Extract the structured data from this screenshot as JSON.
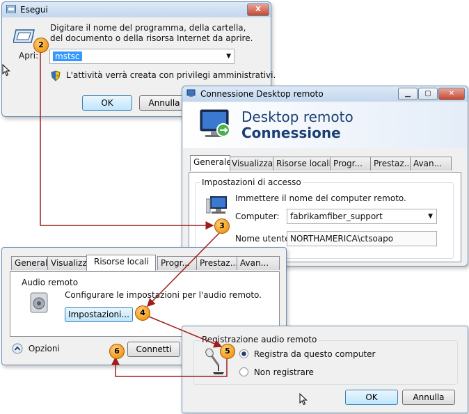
{
  "run_dialog": {
    "title": "Esegui",
    "close_label": "X",
    "description": "Digitare il nome del programma, della cartella,\ndel documento o della risorsa Internet da aprire.",
    "open_label": "Apri:",
    "open_value": "mstsc",
    "admin_note": "L'attività verrà creata con privilegi amministrativi.",
    "ok_label": "OK",
    "cancel_label": "Annulla"
  },
  "rdc_window": {
    "title": "Connessione Desktop remoto",
    "banner_line1": "Desktop remoto",
    "banner_line2": "Connessione",
    "tabs": [
      "Generale",
      "Visualizza",
      "Risorse locali",
      "Progr...",
      "Prestaz...",
      "Avan..."
    ],
    "group_title": "Impostazioni di accesso",
    "instruction": "Immettere il nome del computer remoto.",
    "computer_label": "Computer:",
    "computer_value": "fabrikamfiber_support",
    "username_label": "Nome utente:",
    "username_value": "NORTHAMERICA\\ctsoapo"
  },
  "local_resources_panel": {
    "tabs": [
      "Generale",
      "Visualizza",
      "Risorse locali",
      "Progr...",
      "Prestaz...",
      "Avan..."
    ],
    "group_title": "Audio remoto",
    "description": "Configurare le impostazioni per l'audio remoto.",
    "settings_button": "Impostazioni...",
    "options_label": "Opzioni",
    "connect_button": "Connetti"
  },
  "audio_recording_dialog": {
    "group_title": "Registrazione audio remoto",
    "option_record": "Registra da questo computer",
    "option_no_record": "Non registrare",
    "selected": "Registra da questo computer",
    "ok_label": "OK",
    "cancel_label": "Annulla"
  },
  "callouts": [
    "2",
    "3",
    "4",
    "5",
    "6"
  ],
  "colors": {
    "arrow": "#a11d1d",
    "callout": "#f39a1c",
    "banner_title": "#1b3f73"
  }
}
